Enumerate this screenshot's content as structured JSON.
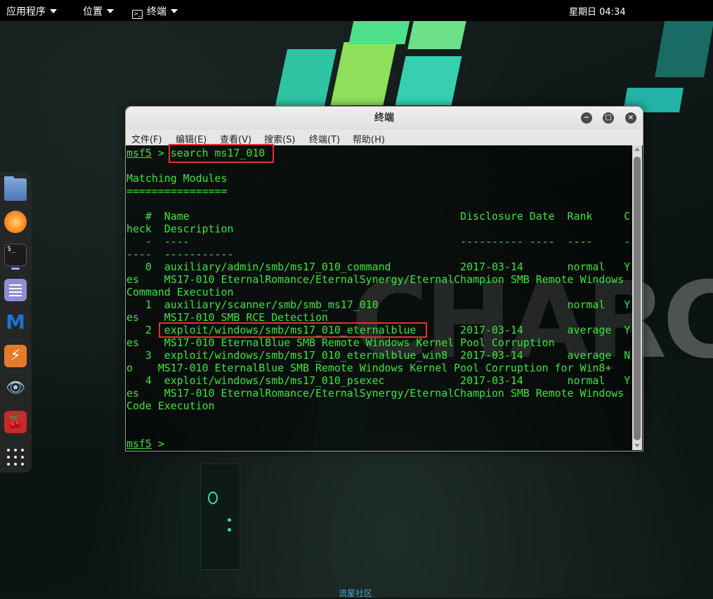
{
  "topbar": {
    "apps_label": "应用程序",
    "places_label": "位置",
    "terminal_label": "终端",
    "clock": "星期日 04:34"
  },
  "dock": {
    "icons": [
      "files-icon",
      "firefox-icon",
      "terminal-icon",
      "notes-icon",
      "metasploit-icon",
      "burpsuite-icon",
      "eye-icon",
      "cherrytree-icon",
      "app-grid-icon"
    ]
  },
  "window": {
    "title": "终端",
    "menus": [
      "文件(F)",
      "编辑(E)",
      "查看(V)",
      "搜索(S)",
      "终端(T)",
      "帮助(H)"
    ],
    "prompt": "msf5",
    "command": "search ms17_010",
    "heading": "Matching Modules",
    "heading_rule": "================",
    "columns": {
      "num": "#",
      "name": "Name",
      "date": "Disclosure Date",
      "rank": "Rank",
      "check": "Check",
      "desc": "Description"
    },
    "modules": [
      {
        "num": "0",
        "name": "auxiliary/admin/smb/ms17_010_command",
        "date": "2017-03-14",
        "rank": "normal",
        "check": "Yes",
        "desc": "MS17-010 EternalRomance/EternalSynergy/EternalChampion SMB Remote Windows Command Execution"
      },
      {
        "num": "1",
        "name": "auxiliary/scanner/smb/smb_ms17_010",
        "date": "",
        "rank": "normal",
        "check": "Yes",
        "desc": "MS17-010 SMB RCE Detection"
      },
      {
        "num": "2",
        "name": "exploit/windows/smb/ms17_010_eternalblue",
        "date": "2017-03-14",
        "rank": "average",
        "check": "Yes",
        "desc": "MS17-010 EternalBlue SMB Remote Windows Kernel Pool Corruption"
      },
      {
        "num": "3",
        "name": "exploit/windows/smb/ms17_010_eternalblue_win8",
        "date": "2017-03-14",
        "rank": "average",
        "check": "No",
        "desc": "MS17-010 EternalBlue SMB Remote Windows Kernel Pool Corruption for Win8+"
      },
      {
        "num": "4",
        "name": "exploit/windows/smb/ms17_010_psexec",
        "date": "2017-03-14",
        "rank": "normal",
        "check": "Yes",
        "desc": "MS17-010 EternalRomance/EternalSynergy/EternalChampion SMB Remote Windows Code Execution"
      }
    ]
  },
  "background_text": "CHARC",
  "watermark": "流星社区",
  "colors": {
    "terminal_text": "#39e639",
    "highlight": "#e53030",
    "topbar": "#000000"
  }
}
